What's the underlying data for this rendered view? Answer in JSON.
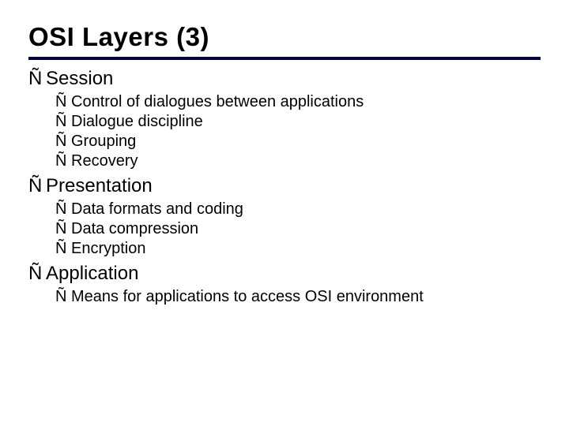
{
  "title": "OSI Layers (3)",
  "bullet": "Ñ",
  "sections": [
    {
      "heading": "Session",
      "items": [
        "Control of dialogues between applications",
        "Dialogue discipline",
        "Grouping",
        "Recovery"
      ]
    },
    {
      "heading": "Presentation",
      "items": [
        "Data formats and coding",
        "Data compression",
        "Encryption"
      ]
    },
    {
      "heading": "Application",
      "items": [
        "Means for applications to access OSI environment"
      ]
    }
  ]
}
